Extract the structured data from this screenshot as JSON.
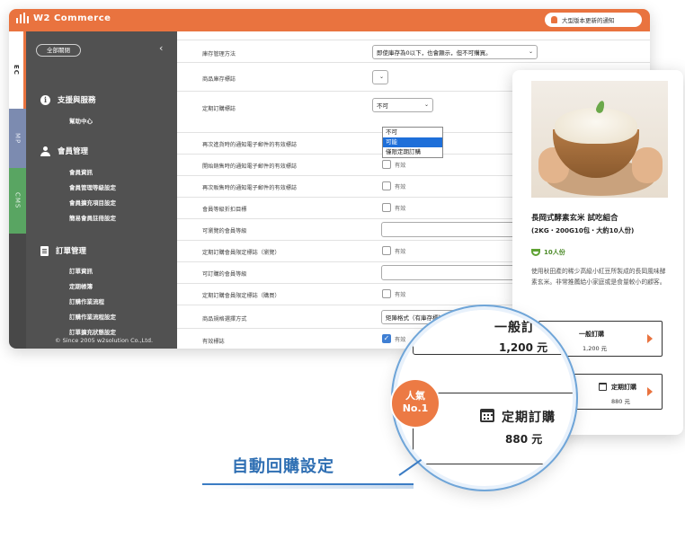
{
  "app": {
    "name": "W2 Commerce",
    "notice": "大型版本更新的通知"
  },
  "side_tabs": [
    "EC",
    "MP",
    "CMS"
  ],
  "sidebar": {
    "expand_all": "全部關閉",
    "sections": [
      {
        "title": "支援與服務",
        "items": [
          "幫助中心"
        ]
      },
      {
        "title": "會員管理",
        "items": [
          "會員資訊",
          "會員管理等級設定",
          "會員擴充項目設定",
          "簡易會員註冊設定"
        ]
      },
      {
        "title": "訂單管理",
        "items": [
          "訂單資訊",
          "定期帳簿",
          "訂購作業流程",
          "訂購作業流程設定",
          "訂單擴充狀態設定"
        ]
      }
    ],
    "copyright": "© Since 2005 w2solution Co.,Ltd."
  },
  "form": {
    "rows": [
      {
        "label": "庫存管理方法",
        "select": "即使庫存為0以下，也會顯示，但不可購買。"
      },
      {
        "label": "商品庫存標誌",
        "select": ""
      },
      {
        "label": "定期訂購標誌",
        "select": "不可"
      },
      {
        "label": "再次進貨時的通知電子郵件的有效標誌",
        "checkbox": "有效"
      },
      {
        "label": "開始銷售時的通知電子郵件的有效標誌",
        "checkbox": "有效"
      },
      {
        "label": "再次販售時的通知電子郵件的有效標誌",
        "checkbox": "有效"
      },
      {
        "label": "會員等級折扣目標",
        "checkbox": "有效"
      },
      {
        "label": "可瀏覽的會員等級"
      },
      {
        "label": "定期訂購會員限定標誌（瀏覽）",
        "checkbox": "有效"
      },
      {
        "label": "可訂購的會員等級"
      },
      {
        "label": "定期訂購會員限定標誌（購買）",
        "checkbox": "有效"
      },
      {
        "label": "商品規格選擇方式",
        "select": "矩陣格式（有庫存標誌"
      },
      {
        "label": "有效標誌",
        "checkbox": "有效",
        "checked": true
      }
    ],
    "dropdown_options": [
      "不可",
      "可能",
      "僅限定期訂購"
    ],
    "dropdown_selected": "可能"
  },
  "product": {
    "title": "長岡式酵素玄米 試吃組合",
    "subtitle": "(2KG・200G10包・大約10人份)",
    "servings": "10人份",
    "description": "使用秋田產的稀少高級小紅豆所製成的長岡風味酵素玄米。非常推薦給小家庭或是食量較小的顧客。",
    "options": [
      {
        "title": "一般訂購",
        "price": "1,200 元"
      },
      {
        "title": "定期訂購",
        "price": "880 元"
      }
    ]
  },
  "zoom": {
    "option1_title": "一般訂",
    "option1_price": "1,200 元",
    "option2_title": "定期訂購",
    "option2_price": "880 元"
  },
  "badge": {
    "line1": "人氣",
    "line2": "No.1"
  },
  "caption": "自動回購設定",
  "colors": {
    "brand": "#e9733f",
    "accent": "#2f6fb3",
    "sidebar": "#515151"
  }
}
